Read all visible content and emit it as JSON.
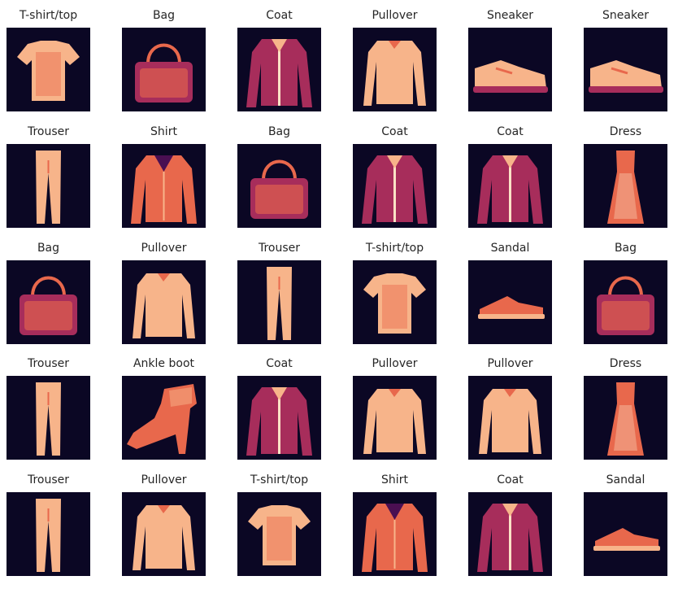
{
  "palette": {
    "background": "#0b0724",
    "dark": "#4a0f52",
    "mid": "#a72d5b",
    "bright": "#e8684c",
    "light": "#f7b48a",
    "pale": "#fce2c6"
  },
  "rows": [
    [
      {
        "label": "T-shirt/top",
        "icon": "tshirt-icon"
      },
      {
        "label": "Bag",
        "icon": "bag-icon"
      },
      {
        "label": "Coat",
        "icon": "coat-icon"
      },
      {
        "label": "Pullover",
        "icon": "pullover-icon"
      },
      {
        "label": "Sneaker",
        "icon": "sneaker-icon"
      },
      {
        "label": "Sneaker",
        "icon": "sneaker-icon"
      }
    ],
    [
      {
        "label": "Trouser",
        "icon": "trouser-icon"
      },
      {
        "label": "Shirt",
        "icon": "shirt-icon"
      },
      {
        "label": "Bag",
        "icon": "bag-icon"
      },
      {
        "label": "Coat",
        "icon": "coat-icon"
      },
      {
        "label": "Coat",
        "icon": "coat-icon"
      },
      {
        "label": "Dress",
        "icon": "dress-icon"
      }
    ],
    [
      {
        "label": "Bag",
        "icon": "bag-icon"
      },
      {
        "label": "Pullover",
        "icon": "pullover-icon"
      },
      {
        "label": "Trouser",
        "icon": "trouser-icon"
      },
      {
        "label": "T-shirt/top",
        "icon": "tshirt-icon"
      },
      {
        "label": "Sandal",
        "icon": "sandal-icon"
      },
      {
        "label": "Bag",
        "icon": "bag-icon"
      }
    ],
    [
      {
        "label": "Trouser",
        "icon": "trouser-icon"
      },
      {
        "label": "Ankle boot",
        "icon": "ankle-boot-icon"
      },
      {
        "label": "Coat",
        "icon": "coat-icon"
      },
      {
        "label": "Pullover",
        "icon": "pullover-icon"
      },
      {
        "label": "Pullover",
        "icon": "pullover-icon"
      },
      {
        "label": "Dress",
        "icon": "dress-icon"
      }
    ],
    [
      {
        "label": "Trouser",
        "icon": "trouser-icon"
      },
      {
        "label": "Pullover",
        "icon": "pullover-icon"
      },
      {
        "label": "T-shirt/top",
        "icon": "tshirt-icon"
      },
      {
        "label": "Shirt",
        "icon": "shirt-icon"
      },
      {
        "label": "Coat",
        "icon": "coat-icon"
      },
      {
        "label": "Sandal",
        "icon": "sandal-icon"
      }
    ]
  ]
}
